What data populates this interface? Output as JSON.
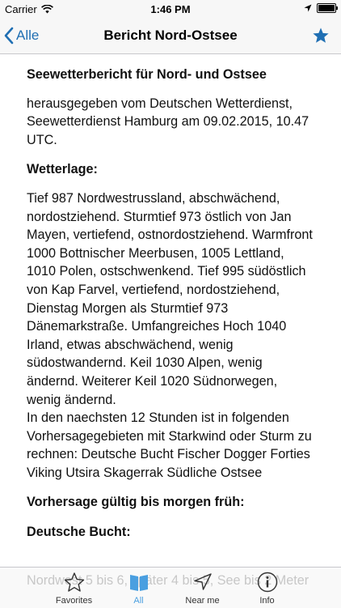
{
  "status_bar": {
    "carrier": "Carrier",
    "time": "1:46 PM"
  },
  "nav": {
    "back_label": "Alle",
    "title": "Bericht Nord-Ostsee"
  },
  "content": {
    "title": "Seewetterbericht für Nord- und Ostsee",
    "issued": "herausgegeben vom Deutschen Wetterdienst, Seewetterdienst Hamburg am 09.02.2015, 10.47 UTC.",
    "weather_heading": "Wetterlage:",
    "weather_text": "Tief 987 Nordwestrussland, abschwächend, nordostziehend. Sturmtief 973 östlich von Jan Mayen, vertiefend, ostnordostziehend. Warmfront 1000 Bottnischer Meerbusen, 1005 Lettland, 1010 Polen, ostschwenkend. Tief 995 südöstlich von Kap Farvel, vertiefend, nordostziehend, Dienstag Morgen als Sturmtief 973 Dänemarkstraße. Umfangreiches Hoch 1040 Irland, etwas abschwächend, wenig südostwandernd. Keil 1030 Alpen, wenig ändernd. Weiterer Keil 1020 Südnorwegen, wenig ändernd.",
    "warning_text": "In den naechsten 12 Stunden ist in folgenden Vorhersagegebieten mit Starkwind oder Sturm zu rechnen: Deutsche Bucht Fischer Dogger Forties Viking Utsira Skagerrak Südliche Ostsee",
    "forecast_heading": "Vorhersage gültig bis morgen früh:",
    "region_heading": "Deutsche Bucht:",
    "region_text": "Nordwest 5 bis 6, später 4 bis 5, See bis 2 Meter"
  },
  "tabs": [
    {
      "label": "Favorites",
      "icon": "star-outline-icon"
    },
    {
      "label": "All",
      "icon": "book-icon"
    },
    {
      "label": "Near me",
      "icon": "location-arrow-icon"
    },
    {
      "label": "Info",
      "icon": "info-icon"
    }
  ],
  "colors": {
    "accent": "#1f6fb3",
    "active_tab": "#4a9fe0"
  }
}
